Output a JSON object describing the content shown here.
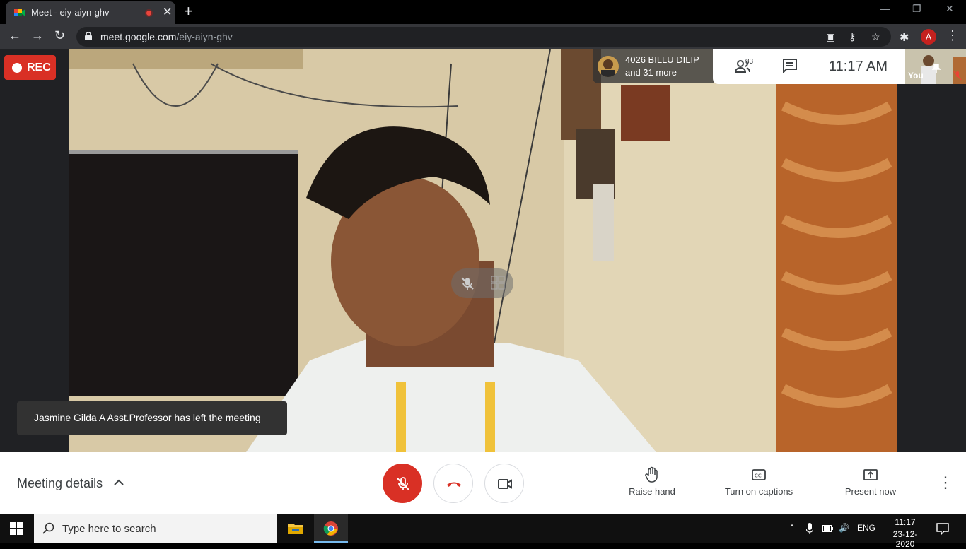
{
  "browser": {
    "tab_title": "Meet - eiy-aiyn-ghv",
    "tab_close": "✕",
    "new_tab": "+",
    "url_host": "meet.google.com",
    "url_path": "/eiy-aiyn-ghv",
    "profile_initial": "A",
    "window_controls": [
      "—",
      "❐",
      "✕"
    ]
  },
  "meet": {
    "rec_label": "REC",
    "presenter_name": "4026 BILLU DILIP",
    "presenter_more": "and 31 more",
    "participant_count": "33",
    "clock": "11:17  AM",
    "self_label": "You",
    "toast": "Jasmine Gilda A Asst.Professor has left the meeting",
    "meeting_details": "Meeting details",
    "actions": {
      "raise_hand": "Raise hand",
      "captions": "Turn on captions",
      "present": "Present now"
    }
  },
  "taskbar": {
    "search_placeholder": "Type here to search",
    "lang": "ENG",
    "time": "11:17",
    "date": "23-12-2020"
  },
  "colors": {
    "accent_red": "#d93025",
    "chrome_dark": "#35363a"
  }
}
